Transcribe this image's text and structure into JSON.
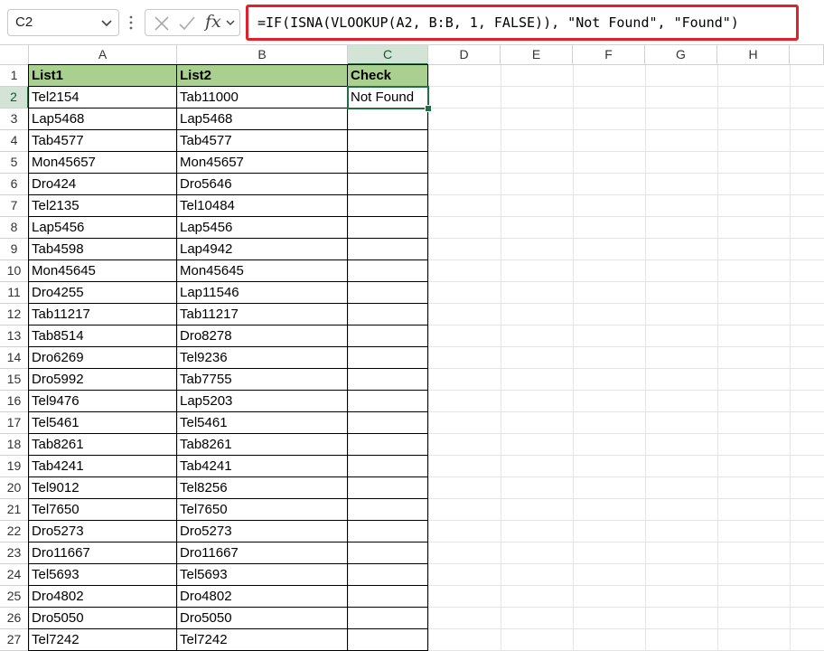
{
  "formula_bar": {
    "name_box": "C2",
    "fx_label": "fx",
    "formula": "=IF(ISNA(VLOOKUP(A2, B:B, 1, FALSE)), \"Not Found\", \"Found\")"
  },
  "columns": [
    "A",
    "B",
    "C",
    "D",
    "E",
    "F",
    "G",
    "H"
  ],
  "selected_cell": "C2",
  "header_row": [
    "List1",
    "List2",
    "Check"
  ],
  "rows": [
    [
      "Tel2154",
      "Tab11000",
      "Not Found"
    ],
    [
      "Lap5468",
      "Lap5468",
      ""
    ],
    [
      "Tab4577",
      "Tab4577",
      ""
    ],
    [
      "Mon45657",
      "Mon45657",
      ""
    ],
    [
      "Dro424",
      "Dro5646",
      ""
    ],
    [
      "Tel2135",
      "Tel10484",
      ""
    ],
    [
      "Lap5456",
      "Lap5456",
      ""
    ],
    [
      "Tab4598",
      "Lap4942",
      ""
    ],
    [
      "Mon45645",
      "Mon45645",
      ""
    ],
    [
      "Dro4255",
      "Lap11546",
      ""
    ],
    [
      "Tab11217",
      "Tab11217",
      ""
    ],
    [
      "Tab8514",
      "Dro8278",
      ""
    ],
    [
      "Dro6269",
      "Tel9236",
      ""
    ],
    [
      "Dro5992",
      "Tab7755",
      ""
    ],
    [
      "Tel9476",
      "Lap5203",
      ""
    ],
    [
      "Tel5461",
      "Tel5461",
      ""
    ],
    [
      "Tab8261",
      "Tab8261",
      ""
    ],
    [
      "Tab4241",
      "Tab4241",
      ""
    ],
    [
      "Tel9012",
      "Tel8256",
      ""
    ],
    [
      "Tel7650",
      "Tel7650",
      ""
    ],
    [
      "Dro5273",
      "Dro5273",
      ""
    ],
    [
      "Dro11667",
      "Dro11667",
      ""
    ],
    [
      "Tel5693",
      "Tel5693",
      ""
    ],
    [
      "Dro4802",
      "Dro4802",
      ""
    ],
    [
      "Dro5050",
      "Dro5050",
      ""
    ],
    [
      "Tel7242",
      "Tel7242",
      ""
    ]
  ],
  "colors": {
    "header_fill": "#a9d08e",
    "formula_highlight": "#e0202a",
    "selection": "#1e7145"
  }
}
